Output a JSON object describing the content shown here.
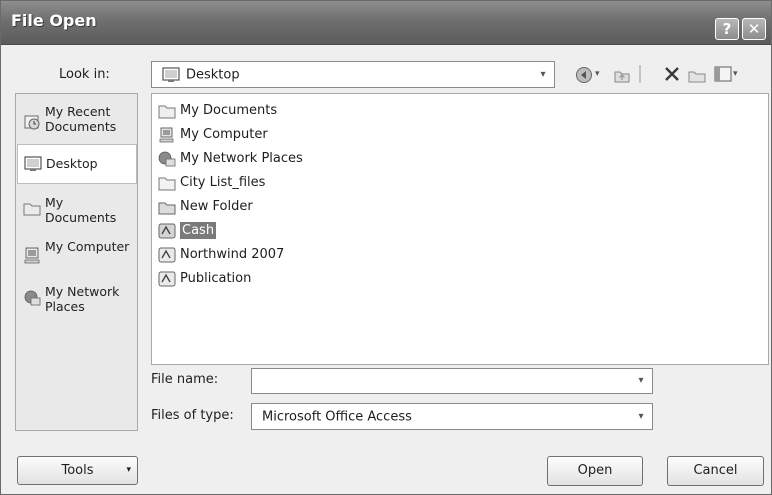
{
  "window": {
    "title": "File Open",
    "help_label": "?",
    "close_label": "✕"
  },
  "look_in": {
    "label": "Look in:",
    "value": "Desktop"
  },
  "toolbar": {
    "icons": [
      "back-icon",
      "dropdown-arrow-icon",
      "up-folder-icon",
      "delete-icon",
      "new-folder-icon",
      "views-icon",
      "dropdown-arrow-icon"
    ]
  },
  "places": [
    {
      "label": "My Recent Documents",
      "icon": "recent-documents-icon",
      "selected": false
    },
    {
      "label": "Desktop",
      "icon": "desktop-icon",
      "selected": true
    },
    {
      "label": "My Documents",
      "icon": "my-documents-icon",
      "selected": false
    },
    {
      "label": "My Computer",
      "icon": "my-computer-icon",
      "selected": false
    },
    {
      "label": "My Network Places",
      "icon": "network-places-icon",
      "selected": false
    }
  ],
  "files": [
    {
      "label": "My Documents",
      "icon": "folder-documents-icon",
      "selected": false
    },
    {
      "label": "My Computer",
      "icon": "computer-icon",
      "selected": false
    },
    {
      "label": "My Network Places",
      "icon": "network-icon",
      "selected": false
    },
    {
      "label": "City List_files",
      "icon": "folder-icon",
      "selected": false
    },
    {
      "label": "New Folder",
      "icon": "folder-icon",
      "selected": false
    },
    {
      "label": "Cash",
      "icon": "access-database-icon",
      "selected": true
    },
    {
      "label": "Northwind 2007",
      "icon": "access-database-icon",
      "selected": false
    },
    {
      "label": "Publication",
      "icon": "access-database-icon",
      "selected": false
    }
  ],
  "file_name": {
    "label": "File name:",
    "value": ""
  },
  "file_type": {
    "label": "Files of type:",
    "value": "Microsoft Office Access"
  },
  "buttons": {
    "tools": "Tools",
    "open": "Open",
    "cancel": "Cancel"
  }
}
